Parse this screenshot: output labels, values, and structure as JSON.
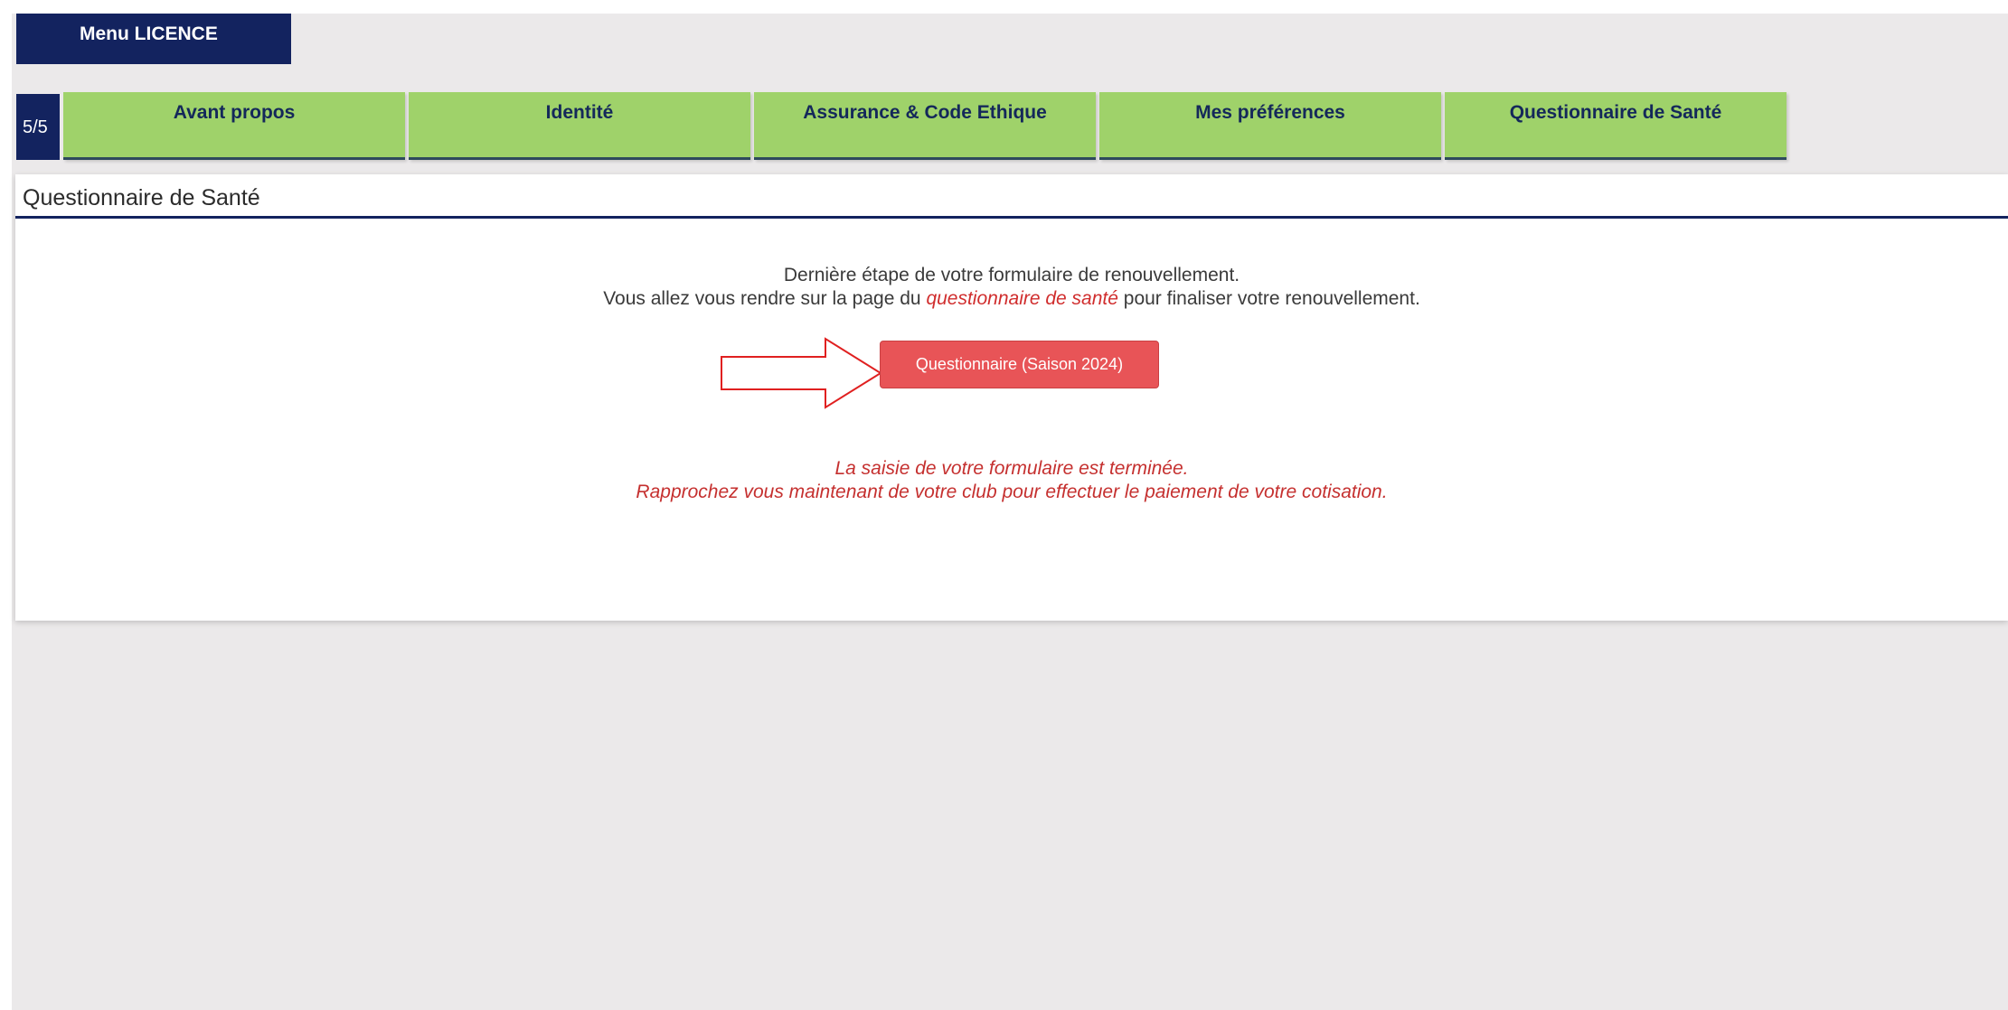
{
  "menu": {
    "label": "Menu LICENCE"
  },
  "progress": {
    "label": "5/5",
    "current": 5,
    "total": 5
  },
  "steps": [
    {
      "label": "Avant propos"
    },
    {
      "label": "Identité"
    },
    {
      "label": "Assurance & Code Ethique"
    },
    {
      "label": "Mes préférences"
    },
    {
      "label": "Questionnaire de Santé"
    }
  ],
  "panel": {
    "title": "Questionnaire de Santé",
    "intro_line1": "Dernière étape de votre formulaire de renouvellement.",
    "intro_line2_before": "Vous allez vous rendre sur la page du ",
    "intro_line2_link": "questionnaire de santé",
    "intro_line2_after": " pour finaliser votre renouvellement.",
    "button_label": "Questionnaire (Saison 2024)",
    "outro_line1": "La saisie de votre formulaire est terminée.",
    "outro_line2": "Rapprochez vous maintenant de votre club pour effectuer le paiement de votre cotisation."
  },
  "colors": {
    "navy": "#13235f",
    "tab_green": "#9fd26a",
    "button_red": "#e85457",
    "highlight_red": "#d02d2d",
    "page_bg": "#ebe9ea"
  },
  "icons": {
    "arrow": "right-arrow-outline-icon"
  }
}
